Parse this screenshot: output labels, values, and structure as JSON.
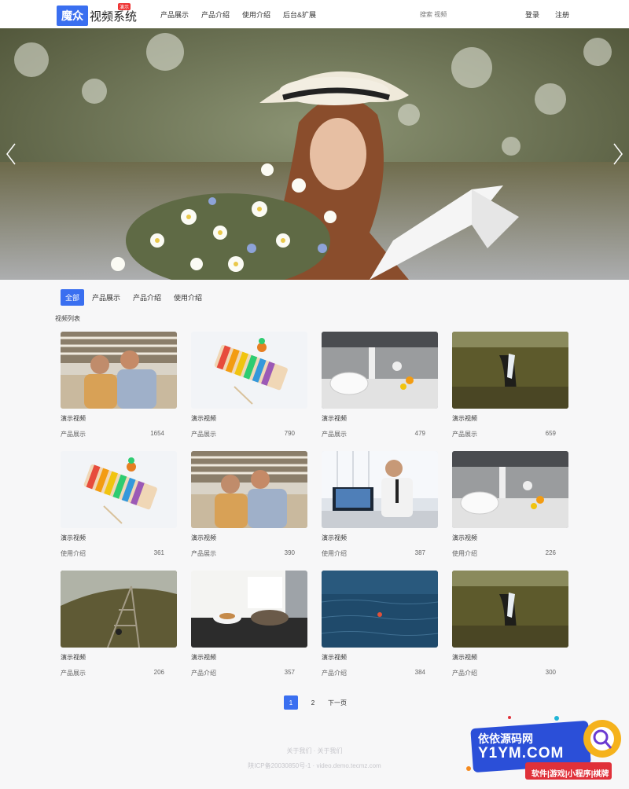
{
  "header": {
    "logo_box": "魔众",
    "logo_text": "视频系统",
    "logo_badge": "演示",
    "nav": [
      "产品展示",
      "产品介绍",
      "使用介绍",
      "后台&扩展"
    ],
    "search_placeholder": "搜索 视频",
    "login": "登录",
    "register": "注册"
  },
  "tabs": [
    {
      "label": "全部",
      "active": true
    },
    {
      "label": "产品展示",
      "active": false
    },
    {
      "label": "产品介绍",
      "active": false
    },
    {
      "label": "使用介绍",
      "active": false
    }
  ],
  "section_title": "视频列表",
  "videos": [
    {
      "title": "演示视频",
      "category": "产品展示",
      "count": "1654",
      "thumb": "friends-sofa"
    },
    {
      "title": "演示视频",
      "category": "产品展示",
      "count": "790",
      "thumb": "xylophone"
    },
    {
      "title": "演示视频",
      "category": "产品展示",
      "count": "479",
      "thumb": "robot-kitchen"
    },
    {
      "title": "演示视频",
      "category": "产品展示",
      "count": "659",
      "thumb": "waterfall"
    },
    {
      "title": "演示视频",
      "category": "使用介绍",
      "count": "361",
      "thumb": "xylophone"
    },
    {
      "title": "演示视频",
      "category": "产品展示",
      "count": "390",
      "thumb": "friends-sofa"
    },
    {
      "title": "演示视频",
      "category": "使用介绍",
      "count": "387",
      "thumb": "businessman-laptop"
    },
    {
      "title": "演示视频",
      "category": "使用介绍",
      "count": "226",
      "thumb": "robot-kitchen"
    },
    {
      "title": "演示视频",
      "category": "产品展示",
      "count": "206",
      "thumb": "tower-climb"
    },
    {
      "title": "演示视频",
      "category": "产品介绍",
      "count": "357",
      "thumb": "chef-cooking"
    },
    {
      "title": "演示视频",
      "category": "产品介绍",
      "count": "384",
      "thumb": "ocean-water"
    },
    {
      "title": "演示视频",
      "category": "产品介绍",
      "count": "300",
      "thumb": "waterfall"
    }
  ],
  "pagination": {
    "pages": [
      "1",
      "2"
    ],
    "next": "下一页",
    "current": "1"
  },
  "footer": {
    "links": "关于我们 · 关于我们",
    "icp": "陕ICP备20030850号-1 · video.demo.tecmz.com"
  },
  "watermark": {
    "line1": "依依源码网",
    "line2": "Y1YM.COM",
    "line3": "软件|游戏|小程序|棋牌"
  },
  "colors": {
    "accent": "#3a6ff0"
  }
}
